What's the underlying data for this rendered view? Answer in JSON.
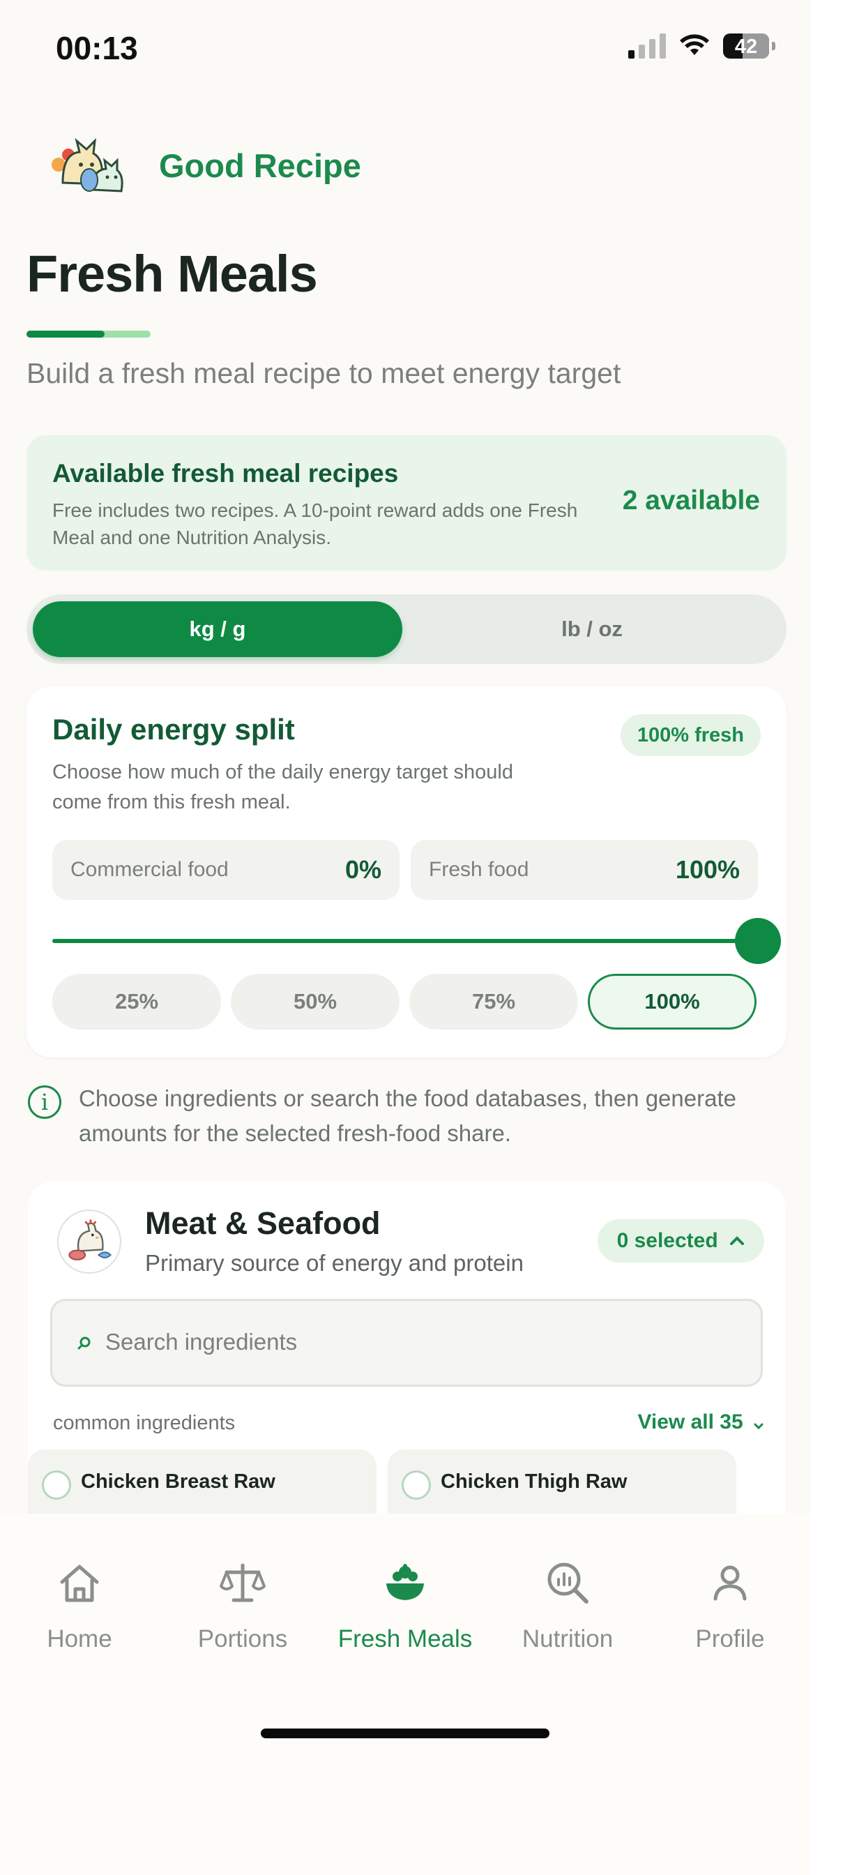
{
  "status": {
    "time": "00:13",
    "battery": "42"
  },
  "brand": {
    "name": "Good Recipe"
  },
  "page": {
    "title": "Fresh Meals",
    "subtitle": "Build a fresh meal recipe to meet energy target"
  },
  "available": {
    "title": "Available fresh meal recipes",
    "description": "Free includes two recipes. A 10-point reward adds one Fresh Meal and one Nutrition Analysis.",
    "count": "2 available"
  },
  "units": {
    "metric": "kg / g",
    "imperial": "lb / oz",
    "selected": "kg / g"
  },
  "energy_split": {
    "title": "Daily energy split",
    "badge": "100% fresh",
    "description": "Choose how much of the daily energy target should come from this fresh meal.",
    "commercial_label": "Commercial food",
    "commercial_value": "0%",
    "fresh_label": "Fresh food",
    "fresh_value": "100%",
    "slider_fraction": 1.0,
    "presets": [
      "25%",
      "50%",
      "75%",
      "100%"
    ],
    "selected_preset": "100%"
  },
  "info": {
    "icon": "info-icon",
    "text": "Choose ingredients or search the food databases, then generate amounts for the selected fresh-food share."
  },
  "meat_section": {
    "title": "Meat & Seafood",
    "subtitle": "Primary source of energy and protein",
    "selected_badge": "0 selected",
    "search_placeholder": "Search ingredients",
    "common_label": "common ingredients",
    "view_all": "View all 35",
    "ingredients": [
      "Chicken Breast Raw",
      "Chicken Thigh Raw"
    ]
  },
  "tabs": [
    {
      "label": "Home",
      "icon": "home-icon"
    },
    {
      "label": "Portions",
      "icon": "scale-icon"
    },
    {
      "label": "Fresh Meals",
      "icon": "bowl-icon",
      "active": true
    },
    {
      "label": "Nutrition",
      "icon": "analytics-search-icon"
    },
    {
      "label": "Profile",
      "icon": "person-icon"
    }
  ],
  "colors": {
    "accent": "#0e8a44",
    "accent_light": "#e6f4e7",
    "background": "#fbfaf6"
  }
}
